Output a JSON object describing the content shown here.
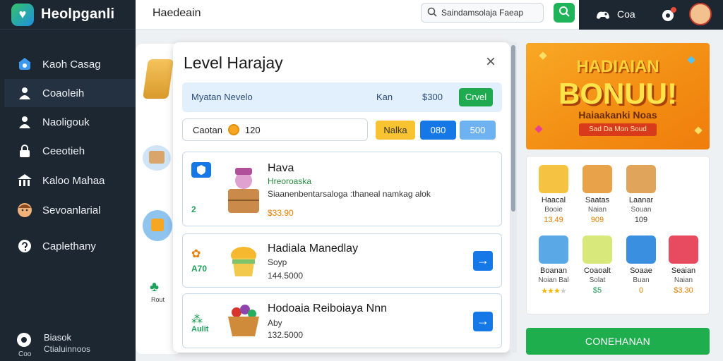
{
  "app": {
    "name": "Heolpganli",
    "page_title": "Haedeain"
  },
  "search": {
    "value": "Saindamsolaja Faeap"
  },
  "user": {
    "label": "Coa"
  },
  "sidebar": {
    "items": [
      {
        "label": "Kaoh Casag",
        "icon": "home-icon"
      },
      {
        "label": "Coaoleih",
        "icon": "user-icon"
      },
      {
        "label": "Naoligouk",
        "icon": "user-icon"
      },
      {
        "label": "Ceeotieh",
        "icon": "lock-icon"
      },
      {
        "label": "Kaloo Mahaa",
        "icon": "store-icon"
      },
      {
        "label": "Sevoanlarial",
        "icon": "avatar-icon"
      },
      {
        "label": "Caplethany",
        "icon": "help-icon"
      }
    ],
    "footer": {
      "title": "Biasok",
      "subtitle": "Ctialuinnoos",
      "badge": "Coo"
    }
  },
  "leftstrip": {
    "caption": "Rout"
  },
  "modal": {
    "title": "Level Harajay",
    "summary": {
      "label": "Myatan Nevelo",
      "col1": "Kan",
      "col2": "$300",
      "button": "Crvel"
    },
    "filter": {
      "label": "Caotan",
      "value": "120"
    },
    "filter_buttons": [
      "Nalka",
      "080",
      "500"
    ],
    "items": [
      {
        "name": "Hava",
        "subtitle": "Hreoroaska",
        "desc": "Siaanenbentarsaloga :thaneal namkag alok",
        "price": "$33.90",
        "badge_text": "2"
      },
      {
        "name": "Hadiala Manedlay",
        "subtitle": "",
        "desc": "Soyp",
        "price": "144.5000",
        "badge_text": "A70"
      },
      {
        "name": "Hodoaia Reiboiaya Nnn",
        "subtitle": "",
        "desc": "Aby",
        "price": "132.5000",
        "badge_text": "Aulit"
      }
    ]
  },
  "banner": {
    "line1": "HADIAIAN",
    "line2": "BONUU!",
    "line3": "Haiaakanki Noas",
    "line4": "Sad Da Mon Soud"
  },
  "rewards": [
    {
      "l1": "Haacal",
      "l2": "Booie",
      "l3": "13.49",
      "color": "#e67e00"
    },
    {
      "l1": "Saatas",
      "l2": "Naian",
      "l3": "909",
      "color": "#e67e00"
    },
    {
      "l1": "Laanar",
      "l2": "Souan",
      "l3": "109",
      "color": "#333333"
    },
    {
      "l1": "Boanan",
      "l2": "Noian Bal",
      "l3": "",
      "color": "#333333"
    },
    {
      "l1": "Coaoalt",
      "l2": "Solat",
      "l3": "$5",
      "color": "#1fa05a"
    },
    {
      "l1": "Soaae",
      "l2": "Buan",
      "l3": "0",
      "color": "#e67e00"
    },
    {
      "l1": "Seaian",
      "l2": "Naian",
      "l3": "$3.30",
      "color": "#e67e00"
    }
  ],
  "cta": {
    "label": "CONEHANAN"
  }
}
